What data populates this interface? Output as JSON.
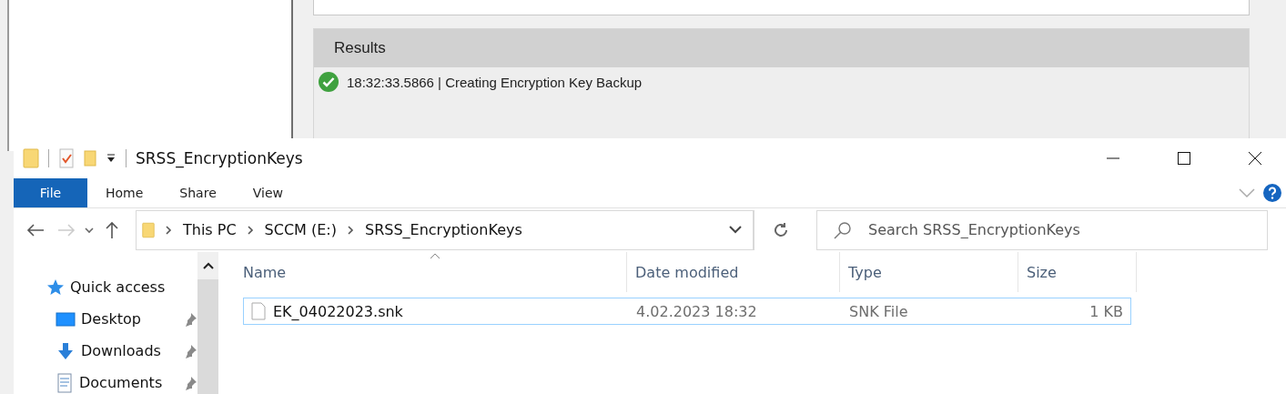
{
  "background_app": {
    "results": {
      "title": "Results",
      "entries": [
        {
          "kind": "success",
          "text": "18:32:33.5866 | Creating Encryption Key Backup"
        }
      ]
    }
  },
  "window": {
    "title": "SRSS_EncryptionKeys"
  },
  "ribbon_tabs": [
    {
      "label": "File",
      "selected": true
    },
    {
      "label": "Home",
      "selected": false
    },
    {
      "label": "Share",
      "selected": false
    },
    {
      "label": "View",
      "selected": false
    }
  ],
  "address": {
    "crumbs": [
      "This PC",
      "SCCM (E:)",
      "SRSS_EncryptionKeys"
    ]
  },
  "search": {
    "placeholder": "Search SRSS_EncryptionKeys"
  },
  "nav_pane": {
    "items": [
      {
        "label": "Quick access",
        "kind": "quick-access",
        "pinned": false
      },
      {
        "label": "Desktop",
        "kind": "desktop",
        "pinned": true
      },
      {
        "label": "Downloads",
        "kind": "downloads",
        "pinned": true
      },
      {
        "label": "Documents",
        "kind": "documents",
        "pinned": true
      }
    ]
  },
  "table": {
    "columns": [
      {
        "label": "Name",
        "sorted": true
      },
      {
        "label": "Date modified",
        "sorted": false
      },
      {
        "label": "Type",
        "sorted": false
      },
      {
        "label": "Size",
        "sorted": false
      }
    ],
    "rows": [
      {
        "name": "EK_04022023.snk",
        "date_modified": "4.02.2023 18:32",
        "type": "SNK File",
        "size": "1 KB",
        "selected": true
      }
    ]
  }
}
